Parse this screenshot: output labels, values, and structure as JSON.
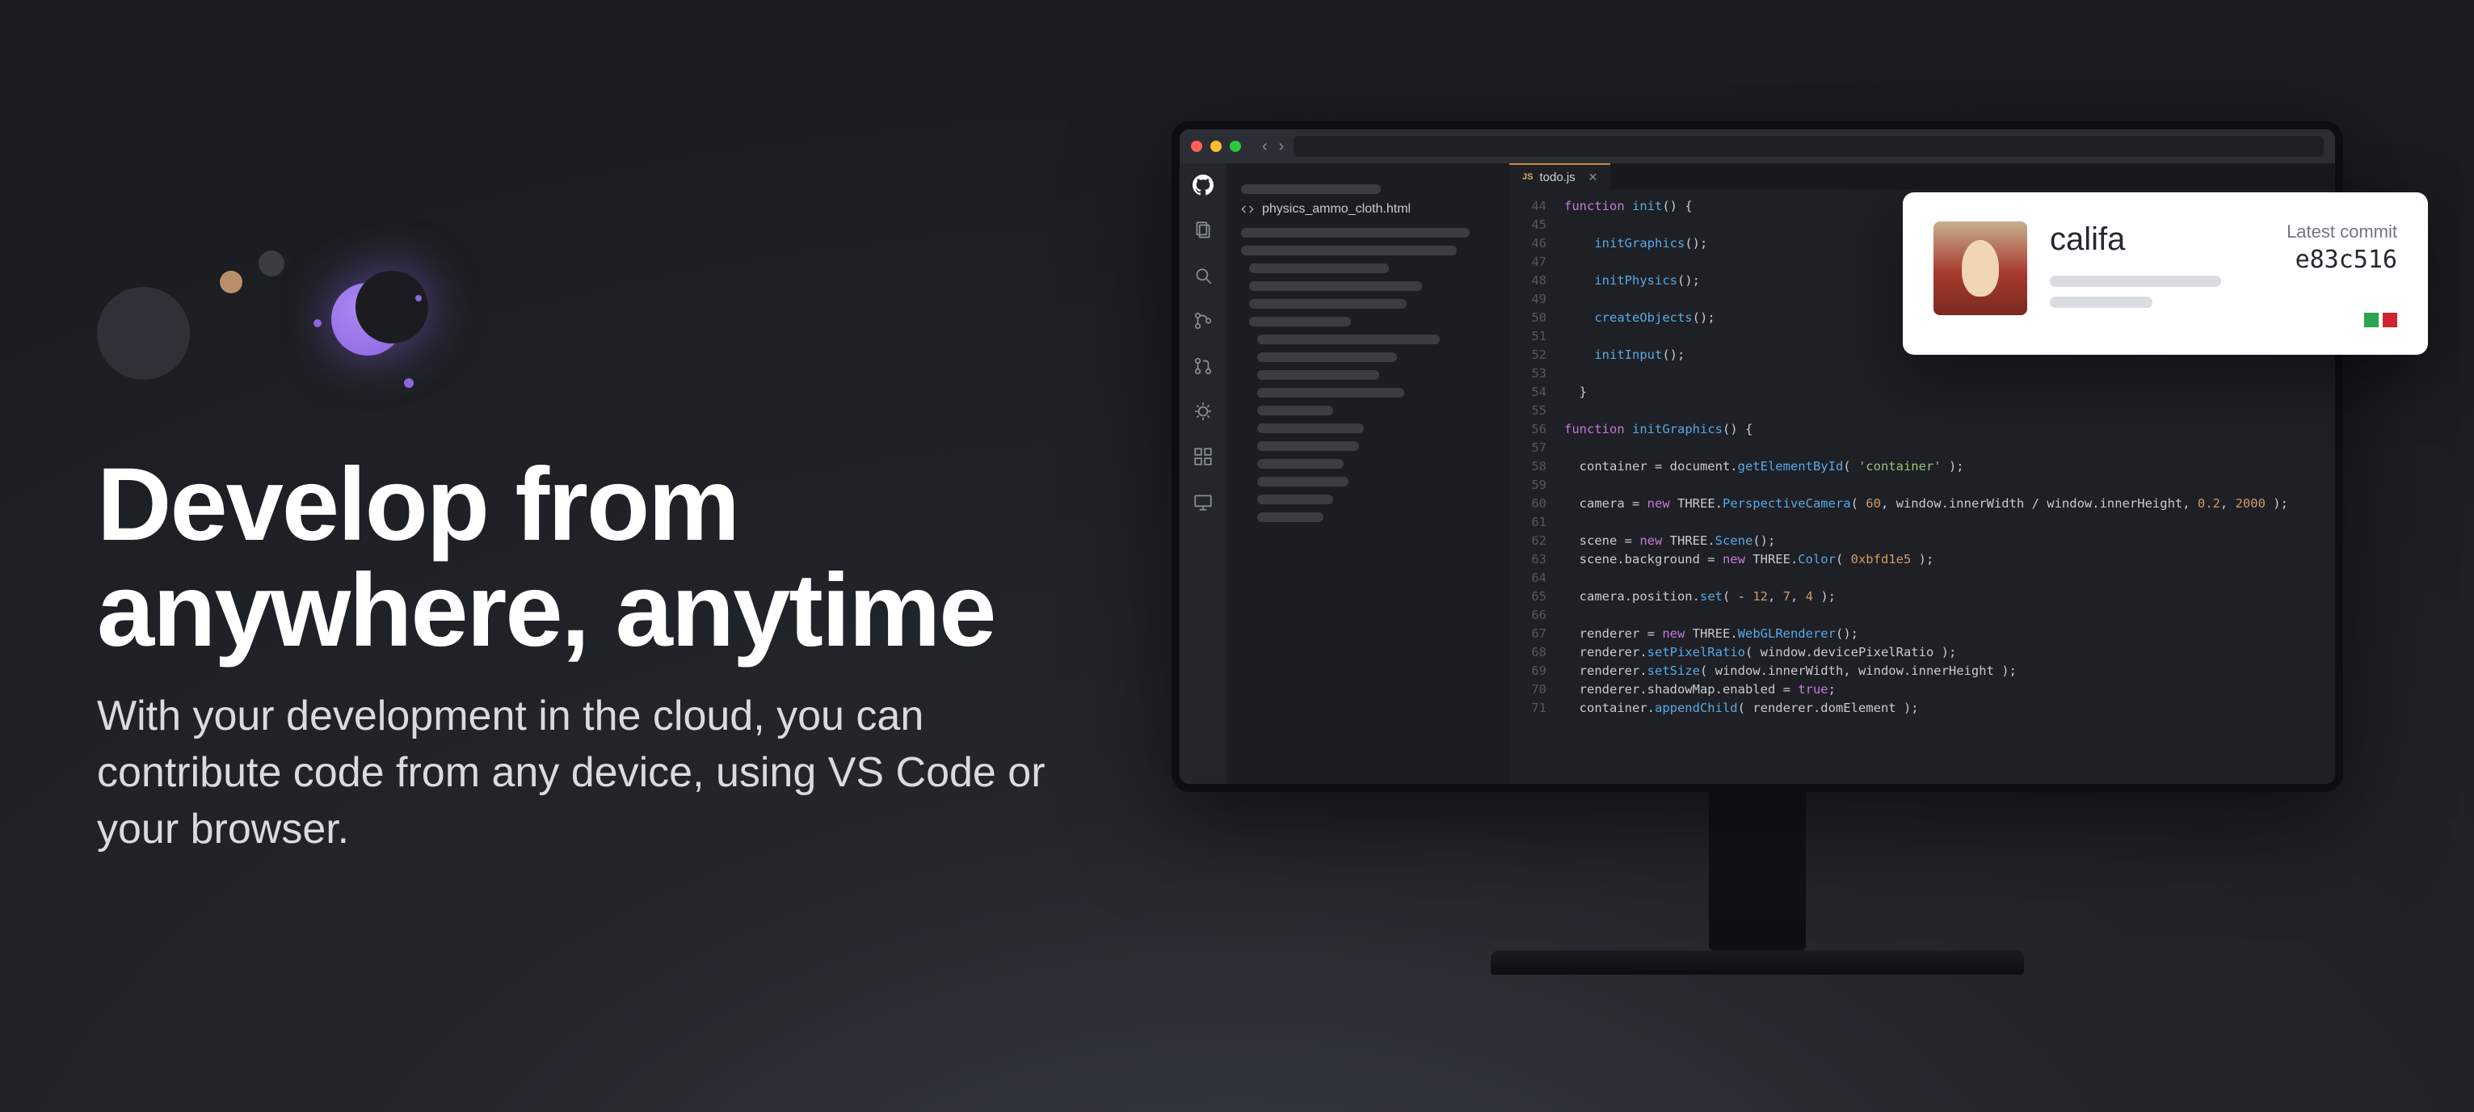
{
  "hero": {
    "title_line1": "Develop from",
    "title_line2": "anywhere, anytime",
    "subtitle": "With your development in the cloud, you can contribute code from any device, using VS Code or your browser."
  },
  "ide": {
    "explorer_open_file": "physics_ammo_cloth.html",
    "tab": {
      "lang_badge": "JS",
      "filename": "todo.js"
    },
    "gutter_start": 44,
    "gutter_end": 71,
    "code_lines": [
      "function init() {",
      "",
      "    initGraphics();",
      "",
      "    initPhysics();",
      "",
      "    createObjects();",
      "",
      "    initInput();",
      "",
      "  }",
      "",
      "function initGraphics() {",
      "",
      "  container = document.getElementById( 'container' );",
      "",
      "  camera = new THREE.PerspectiveCamera( 60, window.innerWidth / window.innerHeight, 0.2, 2000 );",
      "",
      "  scene = new THREE.Scene();",
      "  scene.background = new THREE.Color( 0xbfd1e5 );",
      "",
      "  camera.position.set( - 12, 7, 4 );",
      "",
      "  renderer = new THREE.WebGLRenderer();",
      "  renderer.setPixelRatio( window.devicePixelRatio );",
      "  renderer.setSize( window.innerWidth, window.innerHeight );",
      "  renderer.shadowMap.enabled = true;",
      "  container.appendChild( renderer.domElement );"
    ]
  },
  "card": {
    "username": "califa",
    "latest_commit_label": "Latest commit",
    "sha": "e83c516"
  },
  "activity_icons": [
    "github",
    "files",
    "search",
    "source-control",
    "pull-request",
    "debug",
    "extensions",
    "remote"
  ]
}
